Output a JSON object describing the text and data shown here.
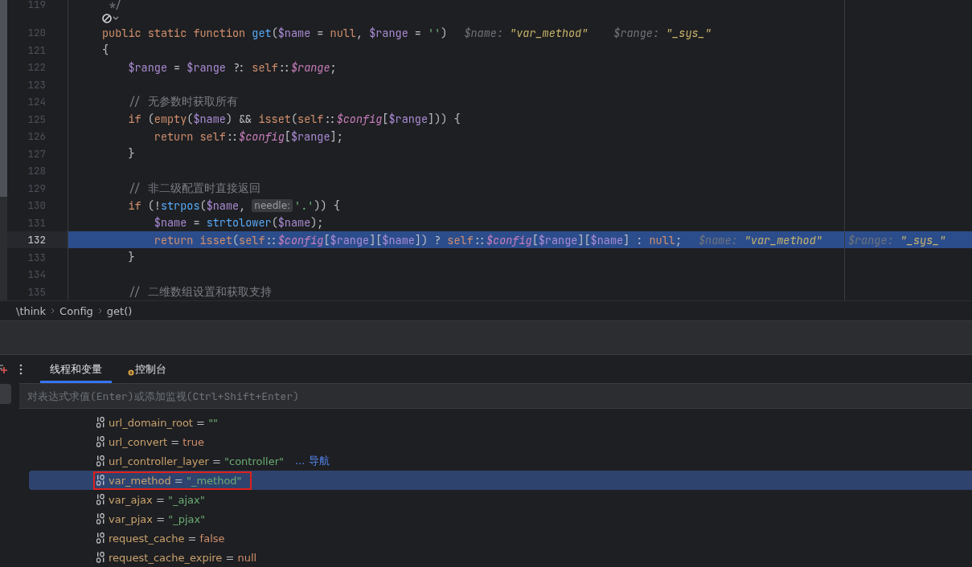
{
  "editor": {
    "lines": [
      {
        "kind": "line",
        "number": "119",
        "current": false,
        "segments": [
          {
            "kind": "code",
            "tokens": [
              {
                "kind": "comment",
                "text": " */"
              }
            ]
          }
        ]
      },
      {
        "kind": "vision"
      },
      {
        "kind": "line",
        "number": "120",
        "current": false,
        "segments": [
          {
            "kind": "code",
            "tokens": [
              {
                "kind": "keyword",
                "text": "public static function "
              },
              {
                "kind": "function",
                "text": "get"
              },
              {
                "kind": "plain",
                "text": "("
              },
              {
                "kind": "variable",
                "text": "$name"
              },
              {
                "kind": "plain",
                "text": " = "
              },
              {
                "kind": "keyword",
                "text": "null"
              },
              {
                "kind": "plain",
                "text": ", "
              },
              {
                "kind": "variable",
                "text": "$range"
              },
              {
                "kind": "plain",
                "text": " = "
              },
              {
                "kind": "string",
                "text": "''"
              },
              {
                "kind": "plain",
                "text": ")"
              }
            ]
          },
          {
            "kind": "hint",
            "label": "$name:",
            "value": "\"var_method\""
          },
          {
            "kind": "hint",
            "label": "$range:",
            "value": "\"_sys_\""
          }
        ]
      },
      {
        "kind": "line",
        "number": "121",
        "current": false,
        "segments": [
          {
            "kind": "code",
            "tokens": [
              {
                "kind": "plain",
                "text": "{"
              }
            ]
          }
        ]
      },
      {
        "kind": "line",
        "number": "122",
        "current": false,
        "segments": [
          {
            "kind": "code",
            "tokens": [
              {
                "kind": "variable",
                "text": "    $range"
              },
              {
                "kind": "plain",
                "text": " = "
              },
              {
                "kind": "variable",
                "text": "$range"
              },
              {
                "kind": "plain",
                "text": " ?: "
              },
              {
                "kind": "keyword",
                "text": "self"
              },
              {
                "kind": "plain",
                "text": "::"
              },
              {
                "kind": "field",
                "text": "$range"
              },
              {
                "kind": "plain",
                "text": ";"
              }
            ]
          }
        ]
      },
      {
        "kind": "line",
        "number": "123",
        "current": false
      },
      {
        "kind": "line",
        "number": "124",
        "current": false,
        "segments": [
          {
            "kind": "code",
            "tokens": [
              {
                "kind": "comment",
                "text": "    // 无参数时获取所有"
              }
            ]
          }
        ]
      },
      {
        "kind": "line",
        "number": "125",
        "current": false,
        "segments": [
          {
            "kind": "code",
            "tokens": [
              {
                "kind": "keyword",
                "text": "    if"
              },
              {
                "kind": "plain",
                "text": " ("
              },
              {
                "kind": "keyword",
                "text": "empty"
              },
              {
                "kind": "plain",
                "text": "("
              },
              {
                "kind": "variable",
                "text": "$name"
              },
              {
                "kind": "plain",
                "text": ") && "
              },
              {
                "kind": "keyword",
                "text": "isset"
              },
              {
                "kind": "plain",
                "text": "("
              },
              {
                "kind": "keyword",
                "text": "self"
              },
              {
                "kind": "plain",
                "text": "::"
              },
              {
                "kind": "field",
                "text": "$config"
              },
              {
                "kind": "plain",
                "text": "["
              },
              {
                "kind": "variable",
                "text": "$range"
              },
              {
                "kind": "plain",
                "text": "])) {"
              }
            ]
          }
        ]
      },
      {
        "kind": "line",
        "number": "126",
        "current": false,
        "segments": [
          {
            "kind": "code",
            "tokens": [
              {
                "kind": "keyword",
                "text": "        return self"
              },
              {
                "kind": "plain",
                "text": "::"
              },
              {
                "kind": "field",
                "text": "$config"
              },
              {
                "kind": "plain",
                "text": "["
              },
              {
                "kind": "variable",
                "text": "$range"
              },
              {
                "kind": "plain",
                "text": "];"
              }
            ]
          }
        ]
      },
      {
        "kind": "line",
        "number": "127",
        "current": false,
        "segments": [
          {
            "kind": "code",
            "tokens": [
              {
                "kind": "plain",
                "text": "    }"
              }
            ]
          }
        ]
      },
      {
        "kind": "line",
        "number": "128",
        "current": false
      },
      {
        "kind": "line",
        "number": "129",
        "current": false,
        "segments": [
          {
            "kind": "code",
            "tokens": [
              {
                "kind": "comment",
                "text": "    // 非二级配置时直接返回"
              }
            ]
          }
        ]
      },
      {
        "kind": "line",
        "number": "130",
        "current": false,
        "segments": [
          {
            "kind": "code",
            "tokens": [
              {
                "kind": "keyword",
                "text": "    if"
              },
              {
                "kind": "plain",
                "text": " (!"
              },
              {
                "kind": "function",
                "text": "strpos"
              },
              {
                "kind": "plain",
                "text": "("
              },
              {
                "kind": "variable",
                "text": "$name"
              },
              {
                "kind": "plain",
                "text": ", "
              }
            ]
          },
          {
            "kind": "inlay",
            "label": "needle:"
          },
          {
            "kind": "code",
            "tokens": [
              {
                "kind": "string",
                "text": "'.'"
              },
              {
                "kind": "plain",
                "text": ")) {"
              }
            ]
          }
        ]
      },
      {
        "kind": "line",
        "number": "131",
        "current": false,
        "segments": [
          {
            "kind": "code",
            "tokens": [
              {
                "kind": "variable",
                "text": "        $name"
              },
              {
                "kind": "plain",
                "text": " = "
              },
              {
                "kind": "function",
                "text": "strtolower"
              },
              {
                "kind": "plain",
                "text": "("
              },
              {
                "kind": "variable",
                "text": "$name"
              },
              {
                "kind": "plain",
                "text": ");"
              }
            ]
          }
        ]
      },
      {
        "kind": "line",
        "number": "132",
        "current": true,
        "segments": [
          {
            "kind": "code",
            "tokens": [
              {
                "kind": "keyword",
                "text": "        return isset"
              },
              {
                "kind": "plain",
                "text": "("
              },
              {
                "kind": "keyword",
                "text": "self"
              },
              {
                "kind": "plain",
                "text": "::"
              },
              {
                "kind": "field",
                "text": "$config"
              },
              {
                "kind": "plain",
                "text": "["
              },
              {
                "kind": "variable",
                "text": "$range"
              },
              {
                "kind": "plain",
                "text": "]["
              },
              {
                "kind": "variable",
                "text": "$name"
              },
              {
                "kind": "plain",
                "text": "]) ? "
              },
              {
                "kind": "keyword",
                "text": "self"
              },
              {
                "kind": "plain",
                "text": "::"
              },
              {
                "kind": "field",
                "text": "$config"
              },
              {
                "kind": "plain",
                "text": "["
              },
              {
                "kind": "variable",
                "text": "$range"
              },
              {
                "kind": "plain",
                "text": "]["
              },
              {
                "kind": "variable",
                "text": "$name"
              },
              {
                "kind": "plain",
                "text": "] : "
              },
              {
                "kind": "keyword",
                "text": "null"
              },
              {
                "kind": "plain",
                "text": ";"
              }
            ]
          },
          {
            "kind": "hint",
            "label": "$name:",
            "value": "\"var_method\""
          },
          {
            "kind": "hint",
            "label": "$range:",
            "value": "\"_sys_\""
          }
        ]
      },
      {
        "kind": "line",
        "number": "133",
        "current": false,
        "segments": [
          {
            "kind": "code",
            "tokens": [
              {
                "kind": "plain",
                "text": "    }"
              }
            ]
          }
        ]
      },
      {
        "kind": "line",
        "number": "134",
        "current": false
      },
      {
        "kind": "line",
        "number": "135",
        "current": false,
        "segments": [
          {
            "kind": "code",
            "tokens": [
              {
                "kind": "comment",
                "text": "    // 二维数组设置和获取支持"
              }
            ]
          }
        ]
      }
    ]
  },
  "breadcrumbs": [
    "\\think",
    "Config",
    "get()"
  ],
  "debug_panel": {
    "tabs": [
      {
        "label": "线程和变量",
        "selected": true,
        "icon": false
      },
      {
        "label": "控制台",
        "selected": false,
        "icon": true
      }
    ],
    "evaluate_field": {
      "placeholder": "对表达式求值(Enter)或添加监视(Ctrl+Shift+Enter)"
    },
    "variables": [
      {
        "name": "url_domain_root",
        "operator": "=",
        "value": "\"\"",
        "kind": "string",
        "selected": false,
        "outlined": false
      },
      {
        "name": "url_convert",
        "operator": "=",
        "value": "true",
        "kind": "literal",
        "selected": false,
        "outlined": false
      },
      {
        "name": "url_controller_layer",
        "operator": "=",
        "value": "\"controller\"",
        "kind": "string",
        "selected": false,
        "outlined": false,
        "link": "... 导航"
      },
      {
        "name": "var_method",
        "operator": "=",
        "value": "\"_method\"",
        "kind": "string",
        "selected": true,
        "outlined": true
      },
      {
        "name": "var_ajax",
        "operator": "=",
        "value": "\"_ajax\"",
        "kind": "string",
        "selected": false,
        "outlined": false
      },
      {
        "name": "var_pjax",
        "operator": "=",
        "value": "\"_pjax\"",
        "kind": "string",
        "selected": false,
        "outlined": false
      },
      {
        "name": "request_cache",
        "operator": "=",
        "value": "false",
        "kind": "literal",
        "selected": false,
        "outlined": false
      },
      {
        "name": "request_cache_expire",
        "operator": "=",
        "value": "null",
        "kind": "literal",
        "selected": false,
        "outlined": false
      }
    ]
  }
}
